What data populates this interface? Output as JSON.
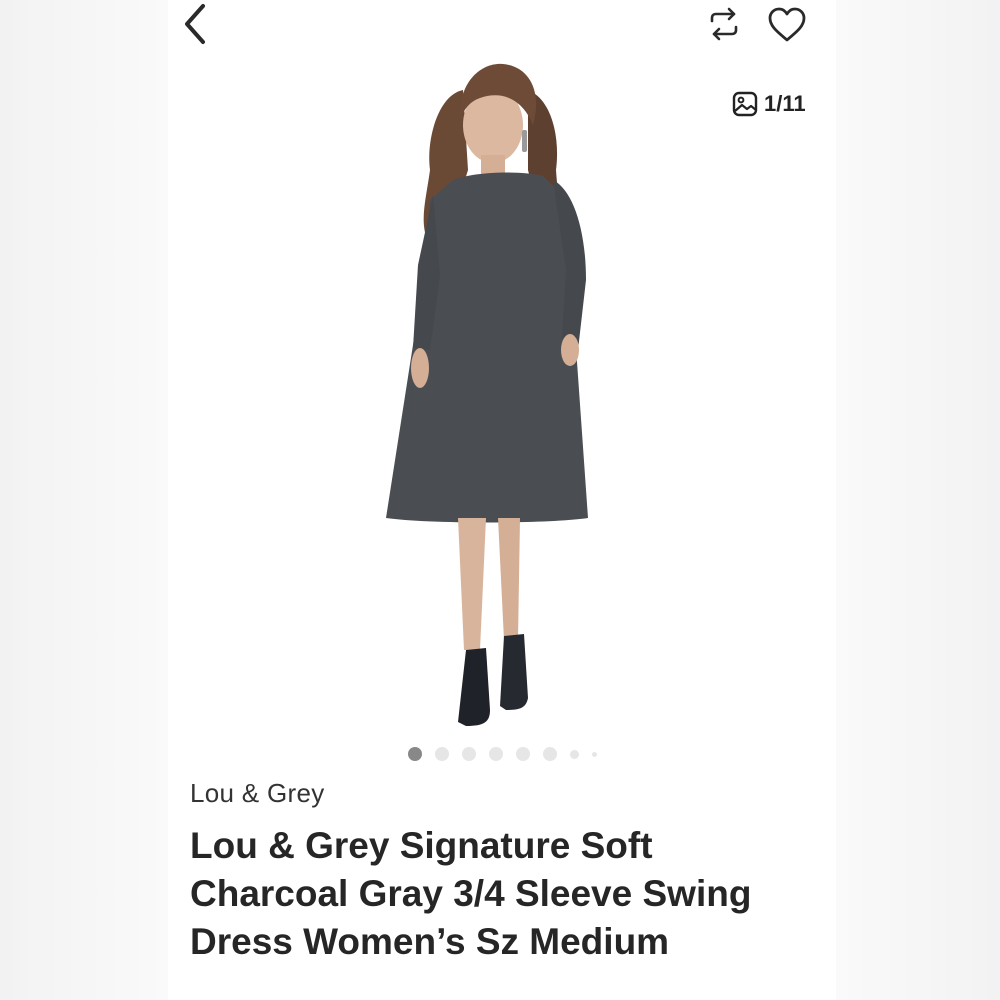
{
  "header": {
    "back_icon": "chevron-left-icon",
    "share_icon": "repeat-icon",
    "like_icon": "heart-icon"
  },
  "gallery": {
    "counter_icon": "image-icon",
    "counter": "1/11",
    "dots_total": 8,
    "active_index": 0
  },
  "product": {
    "brand": "Lou & Grey",
    "title": "Lou & Grey Signature Soft Charcoal Gray 3/4 Sleeve Swing Dress Women’s Sz Medium"
  },
  "colors": {
    "dress": "#4a4d52",
    "hair": "#6b4a35",
    "skin": "#d9b49c",
    "boots": "#1f2228"
  }
}
